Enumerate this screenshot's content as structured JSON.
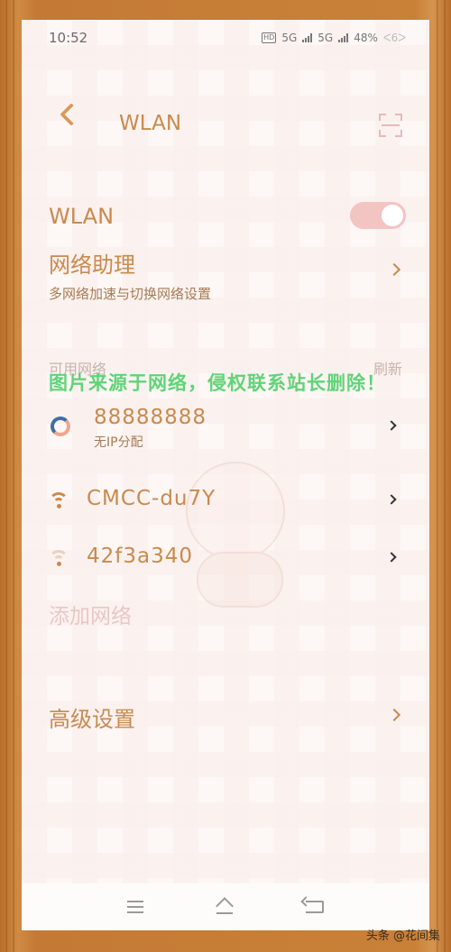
{
  "status_bar": {
    "time": "10:52",
    "hd": "HD",
    "net1": "5G",
    "net2": "5G",
    "battery": "48%",
    "battery_suffix": "ᐸ6ᐳ"
  },
  "header": {
    "title": "WLAN"
  },
  "wlan_toggle": {
    "label": "WLAN",
    "on": true
  },
  "network_assistant": {
    "title": "网络助理",
    "subtitle": "多网络加速与切换网络设置"
  },
  "available": {
    "label": "可用网络",
    "refresh_label": "刷新"
  },
  "watermark": "图片来源于网络，侵权联系站长删除！",
  "networks": [
    {
      "name": "88888888",
      "status": "无IP分配",
      "icon": "connecting-ring-icon"
    },
    {
      "name": "CMCC-du7Y",
      "status": "",
      "icon": "wifi-strong-icon"
    },
    {
      "name": "42f3a340",
      "status": "",
      "icon": "wifi-weak-icon"
    }
  ],
  "add_network_label": "添加网络",
  "advanced_label": "高级设置",
  "credit": "头条 @花间集",
  "colors": {
    "accent": "#c98a4e",
    "toggle_on": "#f2c4c2",
    "watermark": "#4fd16a"
  }
}
